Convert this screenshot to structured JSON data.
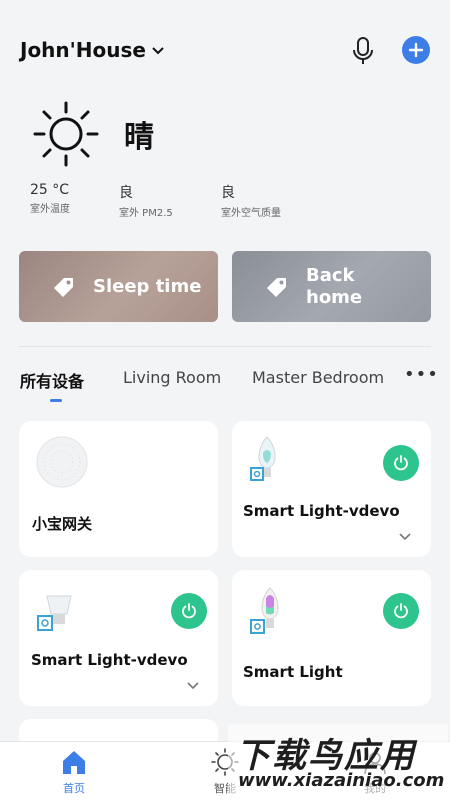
{
  "header": {
    "home_name": "John'House",
    "chevron_icon": "chevron-down-icon",
    "mic_icon": "microphone-icon",
    "add_icon": "plus-icon",
    "accent": "#3d7ee6"
  },
  "weather": {
    "condition": "晴",
    "icon": "sun-icon",
    "metrics": [
      {
        "value": "25 °C",
        "label": "室外温度"
      },
      {
        "value": "良",
        "label": "室外 PM2.5"
      },
      {
        "value": "良",
        "label": "室外空气质量"
      }
    ]
  },
  "scenes": [
    {
      "label": "Sleep time",
      "icon": "tag-icon"
    },
    {
      "label_line1": "Back",
      "label_line2": "home",
      "icon": "tag-icon"
    }
  ],
  "tabs": [
    {
      "label": "所有设备",
      "active": true
    },
    {
      "label": "Living Room"
    },
    {
      "label": "Master Bedroom"
    }
  ],
  "more_label": "•••",
  "devices": [
    {
      "name": "小宝网关",
      "icon": "gateway-icon"
    },
    {
      "name": "Smart Light-vdevo",
      "icon": "bulb-icon",
      "power_icon": "power-icon"
    },
    {
      "name": "Smart Light-vdevo",
      "icon": "spotlight-icon",
      "power_icon": "power-icon"
    },
    {
      "name": "Smart Light",
      "icon": "bulb-icon",
      "power_icon": "power-icon"
    }
  ],
  "power_color": "#2dc48d",
  "nav": [
    {
      "label": "首页",
      "icon": "home-icon",
      "active": true
    },
    {
      "label": "智能",
      "icon": "sun-icon"
    },
    {
      "label": "我的",
      "icon": "user-icon"
    }
  ],
  "watermark": {
    "line1": "下载鸟应用",
    "line2": "www.xiazainiao.com"
  }
}
